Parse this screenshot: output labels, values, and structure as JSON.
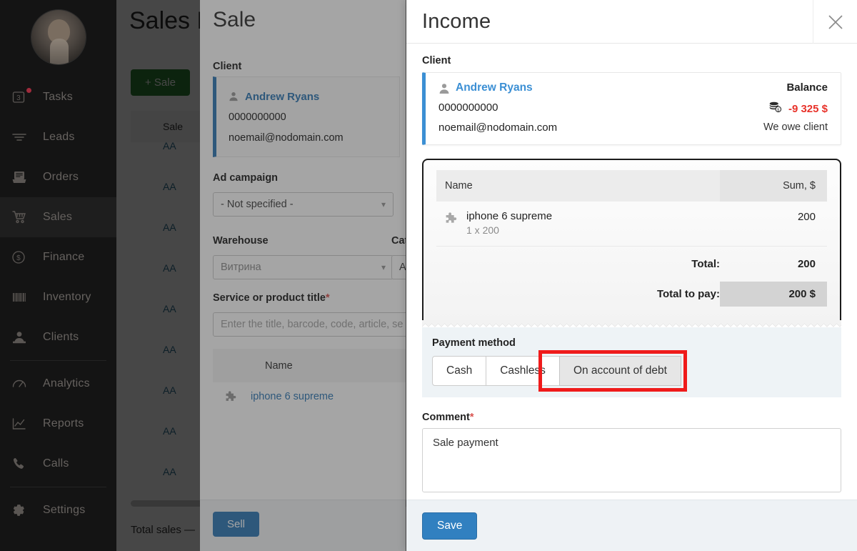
{
  "sidebar": {
    "avatar_name": "user-avatar",
    "items": [
      {
        "label": "Tasks",
        "icon": "tasks-icon",
        "badge": "3",
        "dot": true,
        "active": false
      },
      {
        "label": "Leads",
        "icon": "leads-icon",
        "badge": "",
        "dot": false,
        "active": false
      },
      {
        "label": "Orders",
        "icon": "orders-icon",
        "badge": "",
        "dot": false,
        "active": false
      },
      {
        "label": "Sales",
        "icon": "sales-icon",
        "badge": "",
        "dot": false,
        "active": true
      },
      {
        "label": "Finance",
        "icon": "finance-icon",
        "badge": "",
        "dot": false,
        "active": false
      },
      {
        "label": "Inventory",
        "icon": "inventory-icon",
        "badge": "",
        "dot": false,
        "active": false
      },
      {
        "label": "Clients",
        "icon": "clients-icon",
        "badge": "",
        "dot": false,
        "active": false
      },
      {
        "label": "Analytics",
        "icon": "analytics-icon",
        "badge": "",
        "dot": false,
        "active": false
      },
      {
        "label": "Reports",
        "icon": "reports-icon",
        "badge": "",
        "dot": false,
        "active": false
      },
      {
        "label": "Calls",
        "icon": "calls-icon",
        "badge": "",
        "dot": false,
        "active": false
      },
      {
        "label": "Settings",
        "icon": "settings-icon",
        "badge": "",
        "dot": false,
        "active": false
      }
    ]
  },
  "background_page": {
    "title": "Sales B",
    "add_sale_button": "+  Sale",
    "table_header": "Sale",
    "rows": [
      "AA",
      "AA",
      "AA",
      "AA",
      "AA",
      "AA",
      "AA",
      "AA",
      "AA"
    ],
    "total_sales": "Total sales —"
  },
  "sale_panel": {
    "title": "Sale",
    "client_label": "Client",
    "client": {
      "name": "Andrew Ryans",
      "phone": "0000000000",
      "email": "noemail@nodomain.com"
    },
    "ad_campaign_label": "Ad campaign",
    "ad_campaign_value": "- Not specified -",
    "warehouse_label": "Warehouse",
    "warehouse_value": "Витрина",
    "category_label": "Cat",
    "category_value": "Al",
    "product_title_label": "Service or product title",
    "product_title_required": "*",
    "product_title_placeholder": "Enter the title, barcode, code, article, se",
    "table_header_name": "Name",
    "item_name": "iphone 6 supreme",
    "sell_button": "Sell"
  },
  "income_modal": {
    "title": "Income",
    "close_icon": "close-icon",
    "client_label": "Client",
    "client": {
      "name": "Andrew Ryans",
      "phone": "0000000000",
      "email": "noemail@nodomain.com",
      "balance_label": "Balance",
      "balance_value": "-9 325 $",
      "balance_color": "#e8322a",
      "balance_note": "We owe client",
      "balance_icon": "coins-icon",
      "person_icon": "person-icon",
      "accent_color": "#3b8fd4"
    },
    "receipt": {
      "columns": [
        "Name",
        "Sum, $"
      ],
      "items": [
        {
          "icon": "puzzle-icon",
          "name": "iphone 6 supreme",
          "sub": "1 x 200",
          "sum": "200"
        }
      ],
      "total_label": "Total:",
      "total_value": "200",
      "total_to_pay_label": "Total to pay:",
      "total_to_pay_value": "200 $"
    },
    "payment": {
      "label": "Payment method",
      "options": [
        "Cash",
        "Cashless",
        "On account of debt"
      ],
      "selected": "On account of debt",
      "highlight_color": "#ef1b1b"
    },
    "comment": {
      "label": "Comment",
      "required": "*",
      "value": "Sale payment"
    },
    "save_button": "Save"
  }
}
